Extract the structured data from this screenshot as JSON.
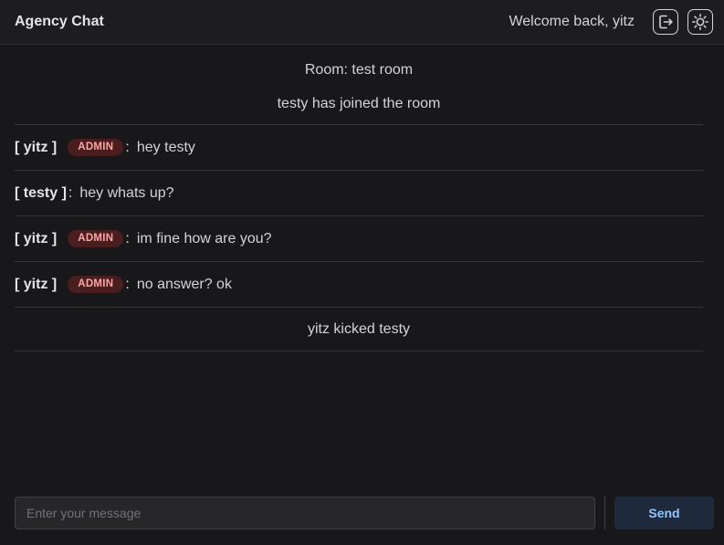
{
  "header": {
    "title": "Agency Chat",
    "welcome": "Welcome back, yitz",
    "logout_icon": "logout-icon",
    "theme_icon": "sun-icon"
  },
  "room": {
    "room_label": "Room: test room",
    "join_notice": "testy has joined the room",
    "messages": [
      {
        "user": "[ yitz ]",
        "badge": "ADMIN",
        "colon": ":",
        "text": "hey testy"
      },
      {
        "user": "[ testy ]",
        "badge": "",
        "colon": ":",
        "text": "hey whats up?"
      },
      {
        "user": "[ yitz ]",
        "badge": "ADMIN",
        "colon": ":",
        "text": "im fine how are you?"
      },
      {
        "user": "[ yitz ]",
        "badge": "ADMIN",
        "colon": ":",
        "text": "no answer? ok"
      }
    ],
    "kick_notice": "yitz kicked testy"
  },
  "composer": {
    "placeholder": "Enter your message",
    "value": "",
    "send_label": "Send"
  },
  "colors": {
    "background": "#18181b",
    "admin_badge_bg": "#4a1d1f",
    "admin_badge_text": "#fca5a5",
    "send_button_bg": "#1e2a3b",
    "send_button_text": "#93c5fd"
  }
}
